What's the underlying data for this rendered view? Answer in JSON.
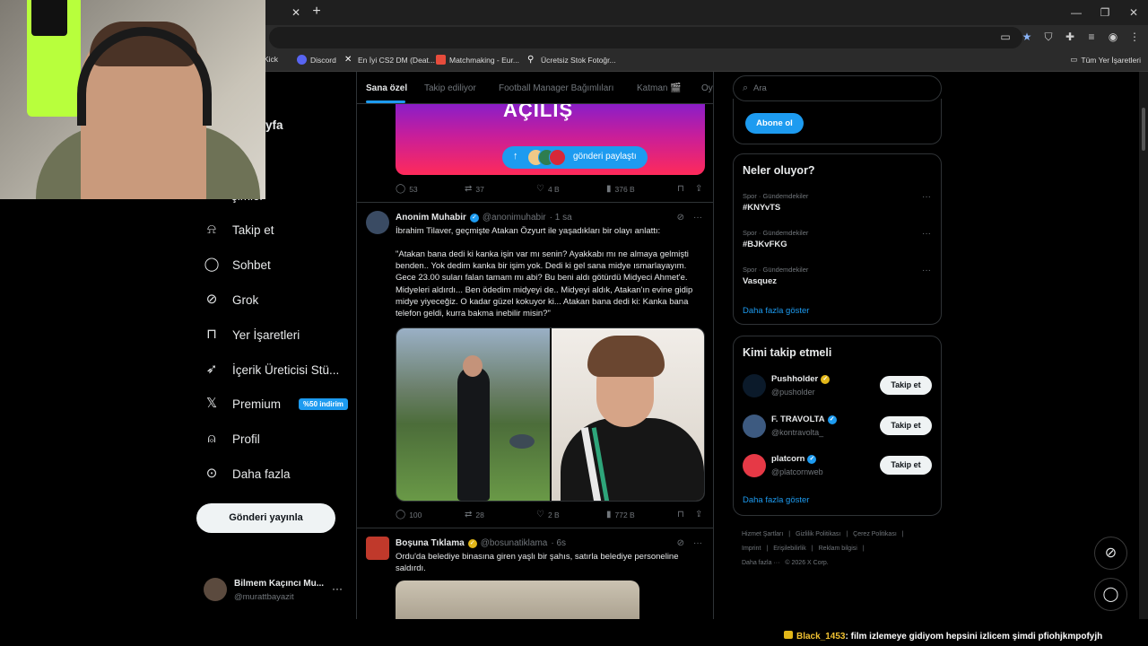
{
  "browser": {
    "bookmarks": [
      {
        "label": "Kick",
        "color": "#53fc18"
      },
      {
        "label": "Discord",
        "color": "#5865f2"
      },
      {
        "label": "En İyi CS2 DM (Deat...",
        "color": "#ffffff"
      },
      {
        "label": "Matchmaking - Eur...",
        "color": "#e74c3c"
      },
      {
        "label": "Ücretsiz Stok Fotoğr...",
        "color": "#ffffff"
      }
    ],
    "all_bookmarks": "Tüm Yer İşaretleri"
  },
  "nav": {
    "partial_top": "yfa",
    "partial_item": "şimler",
    "items": [
      {
        "label": "Takip et",
        "icon": "person-add-icon"
      },
      {
        "label": "Sohbet",
        "icon": "chat-icon"
      },
      {
        "label": "Grok",
        "icon": "grok-icon"
      },
      {
        "label": "Yer İşaretleri",
        "icon": "bookmark-icon"
      },
      {
        "label": "İçerik Üreticisi Stü...",
        "icon": "rocket-icon"
      },
      {
        "label": "Premium",
        "icon": "x-logo-icon"
      },
      {
        "label": "Profil",
        "icon": "person-icon"
      },
      {
        "label": "Daha fazla",
        "icon": "more-circle-icon"
      }
    ],
    "premium_badge": "%50 indirim",
    "post_button": "Gönderi yayınla",
    "account": {
      "name": "Bilmem Kaçıncı Mu...",
      "handle": "@murattbayazit"
    }
  },
  "timeline": {
    "tabs": [
      "Sana özel",
      "Takip ediliyor",
      "Football Manager Bağımlıları",
      "Katman 🎬",
      "Oyu"
    ],
    "promo": {
      "big_text": "AÇILIŞ",
      "share_label": "gönderi paylaştı"
    },
    "promo_stats": {
      "replies": "53",
      "reposts": "37",
      "likes": "4 B",
      "views": "376 B"
    },
    "tweet1": {
      "name": "Anonim Muhabir",
      "handle": "@anonimuhabir",
      "time": "· 1 sa",
      "text1": "İbrahim Tilaver, geçmişte Atakan Özyurt ile yaşadıkları bir olayı anlattı:",
      "text2": "\"Atakan bana dedi ki kanka işin var mı senin? Ayakkabı mı ne almaya gelmişti benden.. Yok dedim kanka bir işim yok. Dedi ki gel sana midye ısmarlayayım. Gece 23.00 suları falan tamam mı abi? Bu beni aldı götürdü Midyeci Ahmet'e. Midyeleri aldırdı... Ben ödedim midyeyi de.. Midyeyi aldık, Atakan'ın evine gidip midye yiyeceğiz. O kadar güzel kokuyor ki... Atakan bana dedi ki: Kanka bana telefon geldi, kurra bakma inebilir misin?\"",
      "replies": "100",
      "reposts": "28",
      "likes": "2 B",
      "views": "772 B"
    },
    "tweet2": {
      "name": "Boşuna Tıklama",
      "handle": "@bosunatiklama",
      "time": "· 6s",
      "text": "Ordu'da belediye binasına giren yaşlı bir şahıs, satırla belediye personeline saldırdı."
    }
  },
  "sidebar": {
    "search_placeholder": "Ara",
    "subscribe_button": "Abone ol",
    "trends_title": "Neler oluyor?",
    "trends": [
      {
        "meta": "Spor · Gündemdekiler",
        "topic": "#KNYvTS"
      },
      {
        "meta": "Spor · Gündemdekiler",
        "topic": "#BJKvFKG"
      },
      {
        "meta": "Spor · Gündemdekiler",
        "topic": "Vasquez"
      }
    ],
    "show_more": "Daha fazla göster",
    "follow_title": "Kimi takip etmeli",
    "follow": [
      {
        "name": "Pushholder",
        "handle": "@pusholder",
        "verified": "gold",
        "button": "Takip et",
        "avatar_color": "#0b1a2a"
      },
      {
        "name": "F. TRAVOLTA",
        "handle": "@kontravolta_",
        "verified": "blue",
        "button": "Takip et",
        "avatar_color": "#3d5a80"
      },
      {
        "name": "platcorn",
        "handle": "@platcornweb",
        "verified": "blue",
        "button": "Takip et",
        "avatar_color": "#e63946"
      }
    ],
    "follow_more": "Daha fazla göster",
    "footer": [
      "Hizmet Şartları",
      "|",
      "Gizlilik Politikası",
      "|",
      "Çerez Politikası",
      "|",
      "Imprint",
      "|",
      "Erişilebilirlik",
      "|",
      "Reklam bilgisi",
      "|",
      "Daha fazla ···",
      "© 2026 X Corp."
    ]
  },
  "chat": {
    "user": "Black_1453",
    "message": ": film izlemeye gidiyom hepsini izlicem şimdi pfiohjkmpofyjh"
  },
  "colors": {
    "accent": "#1d9bf0",
    "background": "#000000",
    "gold": "#e2b719"
  }
}
